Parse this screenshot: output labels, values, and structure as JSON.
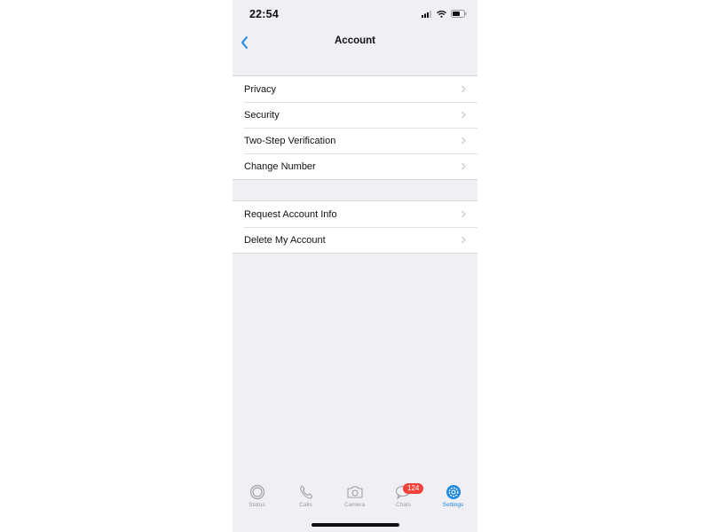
{
  "status_bar": {
    "time": "22:54",
    "icons": [
      "cellular-signal-icon",
      "wifi-icon",
      "battery-icon"
    ]
  },
  "nav": {
    "back_icon": "chevron-left-icon",
    "title": "Account"
  },
  "groups": [
    {
      "items": [
        {
          "label": "Privacy"
        },
        {
          "label": "Security"
        },
        {
          "label": "Two-Step Verification"
        },
        {
          "label": "Change Number"
        }
      ]
    },
    {
      "items": [
        {
          "label": "Request Account Info"
        },
        {
          "label": "Delete My Account"
        }
      ]
    }
  ],
  "tab_bar": {
    "tabs": [
      {
        "label": "Status",
        "icon": "status-icon"
      },
      {
        "label": "Calls",
        "icon": "phone-icon"
      },
      {
        "label": "Camera",
        "icon": "camera-icon"
      },
      {
        "label": "Chats",
        "icon": "chat-bubbles-icon",
        "badge": "124"
      },
      {
        "label": "Settings",
        "icon": "gear-icon",
        "active": true
      }
    ]
  },
  "colors": {
    "accent": "#1d88e4",
    "badge": "#f0413a",
    "background": "#efeff4"
  }
}
